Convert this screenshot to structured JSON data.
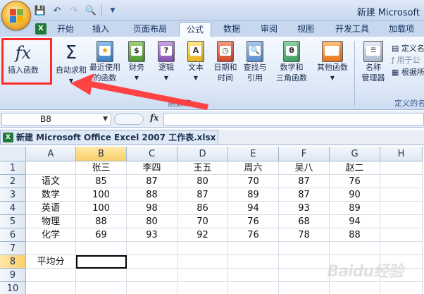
{
  "window": {
    "title": "新建 Microsoft"
  },
  "tabs": [
    {
      "label": "开始",
      "active": false
    },
    {
      "label": "插入",
      "active": false
    },
    {
      "label": "页面布局",
      "active": false
    },
    {
      "label": "公式",
      "active": true
    },
    {
      "label": "数据",
      "active": false
    },
    {
      "label": "审阅",
      "active": false
    },
    {
      "label": "视图",
      "active": false
    },
    {
      "label": "开发工具",
      "active": false
    },
    {
      "label": "加载项",
      "active": false
    }
  ],
  "ribbon": {
    "insert_function": {
      "line1": "插入函数",
      "glyph": "fx"
    },
    "autosum": {
      "line1": "自动求和",
      "glyph": "Σ"
    },
    "recent": {
      "line1": "最近使用",
      "line2": "的函数"
    },
    "finance": {
      "line1": "财务"
    },
    "logic": {
      "line1": "逻辑"
    },
    "text": {
      "line1": "文本"
    },
    "datetime": {
      "line1": "日期和",
      "line2": "时间"
    },
    "lookup": {
      "line1": "查找与",
      "line2": "引用"
    },
    "math": {
      "line1": "数学和",
      "line2": "三角函数"
    },
    "more": {
      "line1": "其他函数"
    },
    "name_manager": {
      "line1": "名称",
      "line2": "管理器"
    },
    "define_name": "定义名",
    "use_in_formula": "用于公",
    "create_from_sel": "根据所",
    "group_library": "函数库",
    "group_names": "定义的名"
  },
  "formula_bar": {
    "name_box": "B8",
    "fx": "fx",
    "value": ""
  },
  "workbook": {
    "title": "新建 Microsoft Office Excel 2007 工作表.xlsx *"
  },
  "sheet": {
    "columns": [
      "A",
      "B",
      "C",
      "D",
      "E",
      "F",
      "G",
      "H"
    ],
    "rows": [
      [
        "",
        "张三",
        "李四",
        "王五",
        "周六",
        "吴八",
        "赵二",
        ""
      ],
      [
        "语文",
        "85",
        "87",
        "80",
        "70",
        "87",
        "76",
        ""
      ],
      [
        "数学",
        "100",
        "88",
        "87",
        "89",
        "87",
        "90",
        ""
      ],
      [
        "英语",
        "100",
        "98",
        "86",
        "94",
        "93",
        "89",
        ""
      ],
      [
        "物理",
        "88",
        "80",
        "70",
        "76",
        "68",
        "94",
        ""
      ],
      [
        "化学",
        "69",
        "93",
        "92",
        "76",
        "78",
        "88",
        ""
      ],
      [
        "",
        "",
        "",
        "",
        "",
        "",
        "",
        ""
      ],
      [
        "平均分",
        "",
        "",
        "",
        "",
        "",
        "",
        ""
      ],
      [
        "",
        "",
        "",
        "",
        "",
        "",
        "",
        ""
      ],
      [
        "",
        "",
        "",
        "",
        "",
        "",
        "",
        ""
      ]
    ],
    "selected": {
      "row": 8,
      "col": "B"
    }
  },
  "watermark": "Baidu经验",
  "colors": {
    "highlight_red": "#ff2a2a",
    "header_selected": "#f9cf6b",
    "ribbon_bg": "#dde8f7"
  }
}
